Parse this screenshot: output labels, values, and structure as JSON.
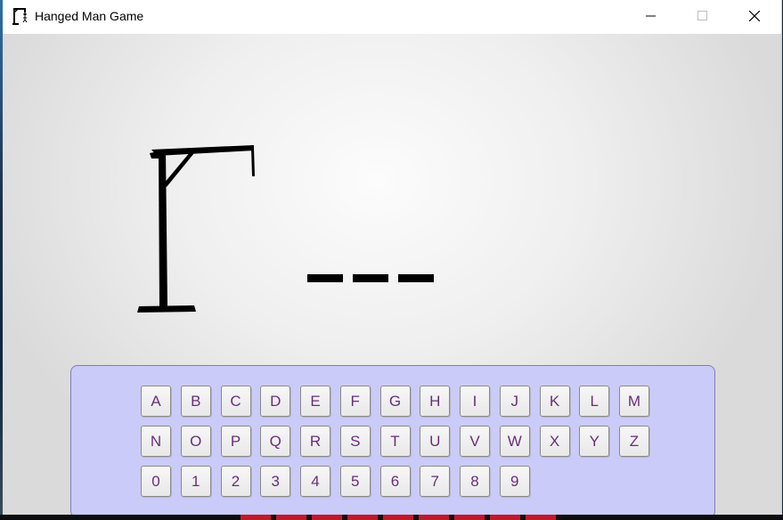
{
  "window": {
    "title": "Hanged Man Game",
    "icon": "gallows-app-icon",
    "controls": [
      "minimize-icon",
      "maximize-icon",
      "close-icon"
    ]
  },
  "game": {
    "wrong_guesses_shown": 0,
    "word_slots": [
      "",
      "",
      ""
    ]
  },
  "keyboard": {
    "rows": [
      [
        "A",
        "B",
        "C",
        "D",
        "E",
        "F",
        "G",
        "H",
        "I",
        "J",
        "K",
        "L",
        "M"
      ],
      [
        "N",
        "O",
        "P",
        "Q",
        "R",
        "S",
        "T",
        "U",
        "V",
        "W",
        "X",
        "Y",
        "Z"
      ],
      [
        "0",
        "1",
        "2",
        "3",
        "4",
        "5",
        "6",
        "7",
        "8",
        "9"
      ]
    ]
  },
  "colors": {
    "key_text": "#6a2d7c",
    "panel_bg": "#cbcbf9"
  }
}
